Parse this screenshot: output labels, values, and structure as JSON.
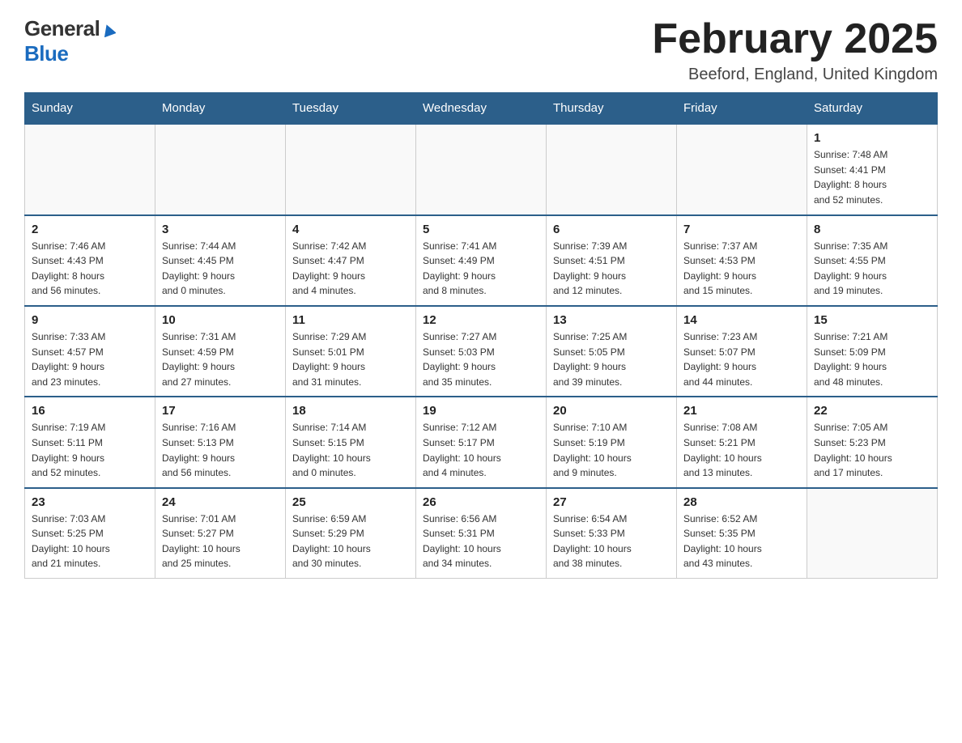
{
  "header": {
    "title": "February 2025",
    "location": "Beeford, England, United Kingdom",
    "logo_general": "General",
    "logo_blue": "Blue"
  },
  "weekdays": [
    "Sunday",
    "Monday",
    "Tuesday",
    "Wednesday",
    "Thursday",
    "Friday",
    "Saturday"
  ],
  "weeks": [
    [
      {
        "day": "",
        "info": ""
      },
      {
        "day": "",
        "info": ""
      },
      {
        "day": "",
        "info": ""
      },
      {
        "day": "",
        "info": ""
      },
      {
        "day": "",
        "info": ""
      },
      {
        "day": "",
        "info": ""
      },
      {
        "day": "1",
        "info": "Sunrise: 7:48 AM\nSunset: 4:41 PM\nDaylight: 8 hours\nand 52 minutes."
      }
    ],
    [
      {
        "day": "2",
        "info": "Sunrise: 7:46 AM\nSunset: 4:43 PM\nDaylight: 8 hours\nand 56 minutes."
      },
      {
        "day": "3",
        "info": "Sunrise: 7:44 AM\nSunset: 4:45 PM\nDaylight: 9 hours\nand 0 minutes."
      },
      {
        "day": "4",
        "info": "Sunrise: 7:42 AM\nSunset: 4:47 PM\nDaylight: 9 hours\nand 4 minutes."
      },
      {
        "day": "5",
        "info": "Sunrise: 7:41 AM\nSunset: 4:49 PM\nDaylight: 9 hours\nand 8 minutes."
      },
      {
        "day": "6",
        "info": "Sunrise: 7:39 AM\nSunset: 4:51 PM\nDaylight: 9 hours\nand 12 minutes."
      },
      {
        "day": "7",
        "info": "Sunrise: 7:37 AM\nSunset: 4:53 PM\nDaylight: 9 hours\nand 15 minutes."
      },
      {
        "day": "8",
        "info": "Sunrise: 7:35 AM\nSunset: 4:55 PM\nDaylight: 9 hours\nand 19 minutes."
      }
    ],
    [
      {
        "day": "9",
        "info": "Sunrise: 7:33 AM\nSunset: 4:57 PM\nDaylight: 9 hours\nand 23 minutes."
      },
      {
        "day": "10",
        "info": "Sunrise: 7:31 AM\nSunset: 4:59 PM\nDaylight: 9 hours\nand 27 minutes."
      },
      {
        "day": "11",
        "info": "Sunrise: 7:29 AM\nSunset: 5:01 PM\nDaylight: 9 hours\nand 31 minutes."
      },
      {
        "day": "12",
        "info": "Sunrise: 7:27 AM\nSunset: 5:03 PM\nDaylight: 9 hours\nand 35 minutes."
      },
      {
        "day": "13",
        "info": "Sunrise: 7:25 AM\nSunset: 5:05 PM\nDaylight: 9 hours\nand 39 minutes."
      },
      {
        "day": "14",
        "info": "Sunrise: 7:23 AM\nSunset: 5:07 PM\nDaylight: 9 hours\nand 44 minutes."
      },
      {
        "day": "15",
        "info": "Sunrise: 7:21 AM\nSunset: 5:09 PM\nDaylight: 9 hours\nand 48 minutes."
      }
    ],
    [
      {
        "day": "16",
        "info": "Sunrise: 7:19 AM\nSunset: 5:11 PM\nDaylight: 9 hours\nand 52 minutes."
      },
      {
        "day": "17",
        "info": "Sunrise: 7:16 AM\nSunset: 5:13 PM\nDaylight: 9 hours\nand 56 minutes."
      },
      {
        "day": "18",
        "info": "Sunrise: 7:14 AM\nSunset: 5:15 PM\nDaylight: 10 hours\nand 0 minutes."
      },
      {
        "day": "19",
        "info": "Sunrise: 7:12 AM\nSunset: 5:17 PM\nDaylight: 10 hours\nand 4 minutes."
      },
      {
        "day": "20",
        "info": "Sunrise: 7:10 AM\nSunset: 5:19 PM\nDaylight: 10 hours\nand 9 minutes."
      },
      {
        "day": "21",
        "info": "Sunrise: 7:08 AM\nSunset: 5:21 PM\nDaylight: 10 hours\nand 13 minutes."
      },
      {
        "day": "22",
        "info": "Sunrise: 7:05 AM\nSunset: 5:23 PM\nDaylight: 10 hours\nand 17 minutes."
      }
    ],
    [
      {
        "day": "23",
        "info": "Sunrise: 7:03 AM\nSunset: 5:25 PM\nDaylight: 10 hours\nand 21 minutes."
      },
      {
        "day": "24",
        "info": "Sunrise: 7:01 AM\nSunset: 5:27 PM\nDaylight: 10 hours\nand 25 minutes."
      },
      {
        "day": "25",
        "info": "Sunrise: 6:59 AM\nSunset: 5:29 PM\nDaylight: 10 hours\nand 30 minutes."
      },
      {
        "day": "26",
        "info": "Sunrise: 6:56 AM\nSunset: 5:31 PM\nDaylight: 10 hours\nand 34 minutes."
      },
      {
        "day": "27",
        "info": "Sunrise: 6:54 AM\nSunset: 5:33 PM\nDaylight: 10 hours\nand 38 minutes."
      },
      {
        "day": "28",
        "info": "Sunrise: 6:52 AM\nSunset: 5:35 PM\nDaylight: 10 hours\nand 43 minutes."
      },
      {
        "day": "",
        "info": ""
      }
    ]
  ]
}
